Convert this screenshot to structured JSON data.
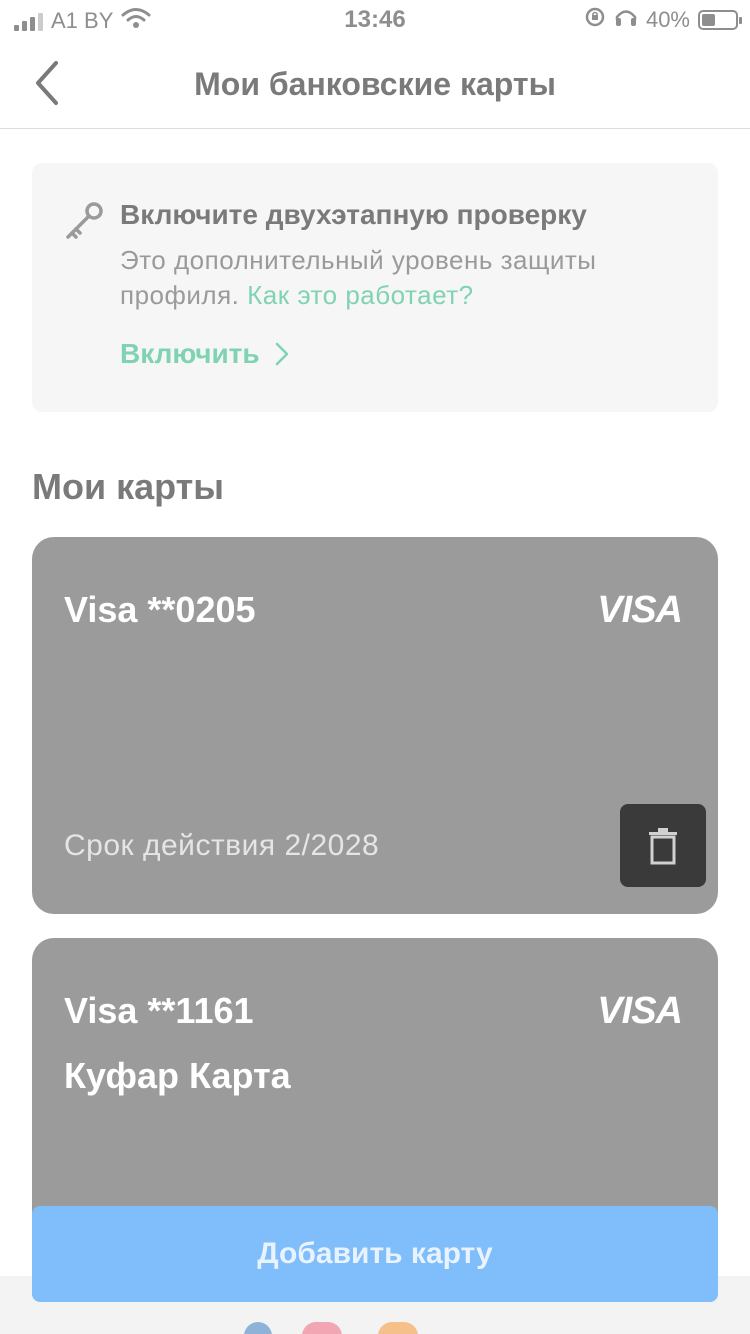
{
  "status_bar": {
    "carrier": "A1 BY",
    "time": "13:46",
    "battery": "40%",
    "battery_level": 0.4,
    "icons": [
      "signal-icon",
      "wifi-icon",
      "rotation-lock-icon",
      "headphones-icon",
      "battery-icon"
    ]
  },
  "header": {
    "title": "Мои банковские карты",
    "back_icon": "chevron-left-icon"
  },
  "promo": {
    "icon": "key-icon",
    "title": "Включите двухэтапную проверку",
    "text": "Это дополнительный уровень защиты профиля.",
    "link": "Как это работает?",
    "action": "Включить",
    "action_icon": "chevron-right-icon"
  },
  "cards_section": {
    "title": "Мои карты",
    "cards": [
      {
        "name": "Visa **0205",
        "brand": "VISA",
        "expiry": "Срок действия 2/2028",
        "delete_icon": "trash-icon"
      },
      {
        "name": "Visa **1161",
        "subtitle": "Куфар Карта",
        "brand": "VISA"
      }
    ]
  },
  "add_card_button": "Добавить карту",
  "colors": {
    "accent_green": "#7fd3b3",
    "primary_blue": "#80bdfb",
    "card_gray": "#9b9b9b",
    "delete_dark": "#3a3a3a"
  }
}
